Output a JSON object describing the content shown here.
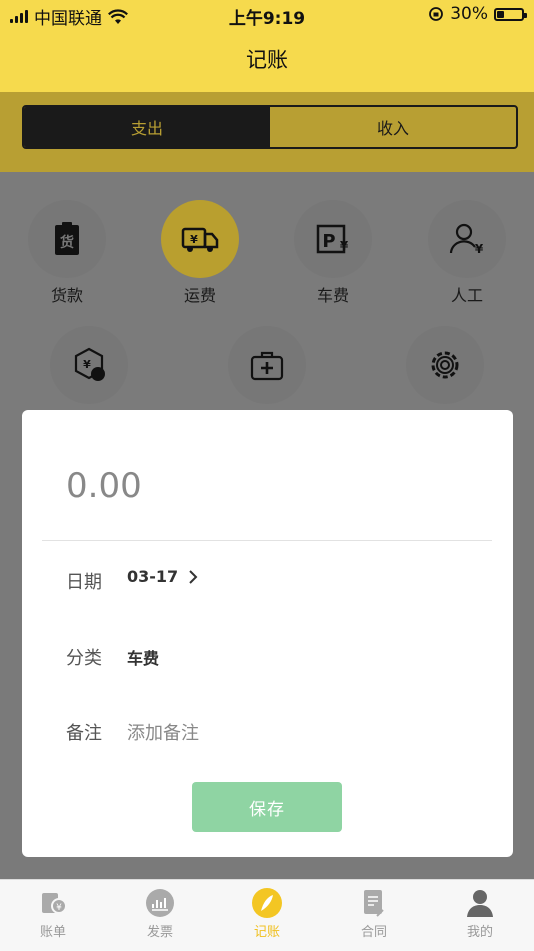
{
  "status_bar": {
    "carrier": "中国联通",
    "time": "上午9:19",
    "battery_pct": "30%",
    "battery_level": 0.3,
    "icons": [
      "signal-icon",
      "wifi-icon",
      "rotation-lock-icon",
      "battery-icon"
    ]
  },
  "header": {
    "title": "记账"
  },
  "segment": {
    "tabs": [
      {
        "label": "支出",
        "selected": true
      },
      {
        "label": "收入",
        "selected": false
      }
    ]
  },
  "categories": [
    {
      "label": "货款",
      "icon": "goods-clipboard-icon",
      "selected": false
    },
    {
      "label": "运费",
      "icon": "freight-truck-icon",
      "selected": true
    },
    {
      "label": "车费",
      "icon": "parking-fee-icon",
      "selected": false
    },
    {
      "label": "人工",
      "icon": "labor-person-icon",
      "selected": false
    },
    {
      "label": "",
      "icon": "fine-coin-icon",
      "selected": false
    },
    {
      "label": "",
      "icon": "medical-kit-icon",
      "selected": false
    },
    {
      "label": "",
      "icon": "settings-gear-icon",
      "selected": false
    }
  ],
  "form": {
    "amount": "0.00",
    "date_label": "日期",
    "date_value": "03-17",
    "category_label": "分类",
    "category_value": "车费",
    "note_label": "备注",
    "note_placeholder": "添加备注",
    "save_label": "保存"
  },
  "tabbar": {
    "items": [
      {
        "label": "账单",
        "icon": "bill-icon",
        "active": false
      },
      {
        "label": "发票",
        "icon": "invoice-chart-icon",
        "active": false
      },
      {
        "label": "记账",
        "icon": "quill-icon",
        "active": true
      },
      {
        "label": "合同",
        "icon": "contract-doc-icon",
        "active": false
      },
      {
        "label": "我的",
        "icon": "profile-person-icon",
        "active": false
      }
    ]
  },
  "colors": {
    "brand_yellow": "#f6da4d",
    "save_green": "#8fd4a3",
    "overlay_gray": "#7b7b7b"
  }
}
